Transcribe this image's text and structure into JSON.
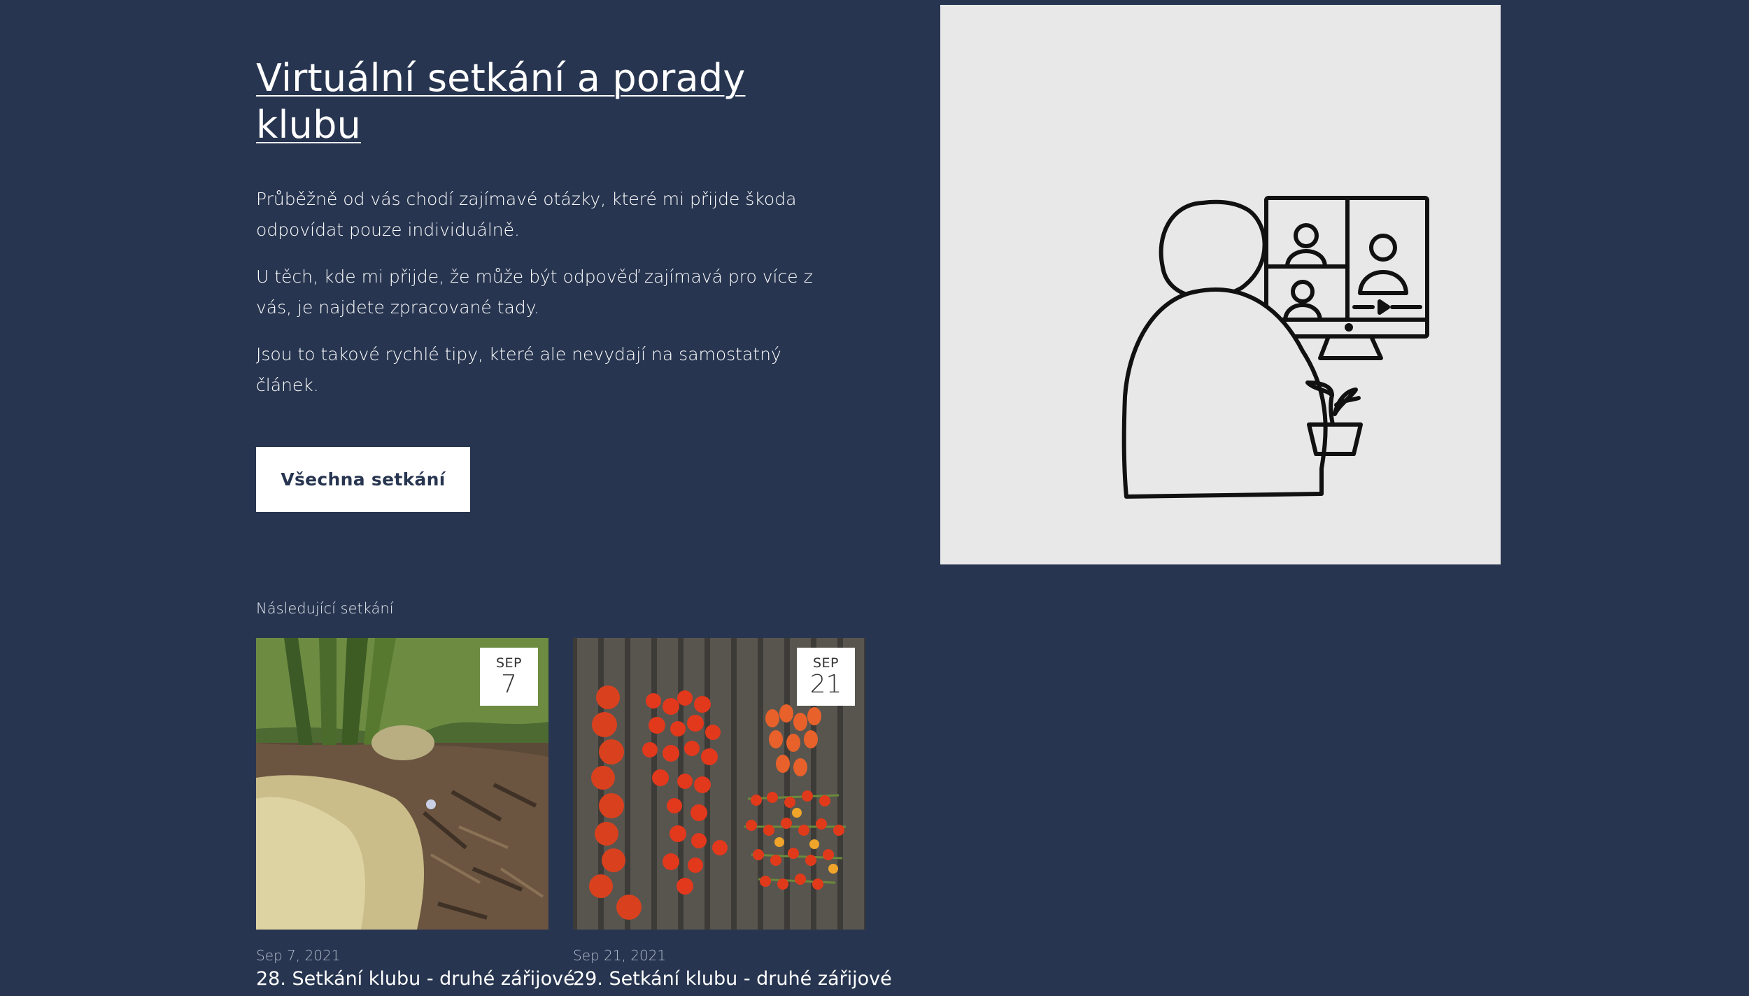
{
  "hero": {
    "title": "Virtuální setkání a porady klubu",
    "paragraphs": [
      "Průběžně od vás chodí zajímavé otázky, které mi přijde škoda odpovídat pouze individuálně.",
      "U těch, kde mi přijde,  že může být odpověď zajímavá pro více z vás, je najdete zpracované tady.",
      "Jsou to takové rychlé tipy, které ale nevydají na samostatný článek."
    ],
    "button_label": "Všechna setkání"
  },
  "illustration": {
    "icon": "video-call-illustration",
    "background": "#e8e8e8"
  },
  "upcoming": {
    "label": "Následující setkání",
    "events": [
      {
        "month": "SEP",
        "day": "7",
        "date": "Sep 7, 2021",
        "title": "28. Setkání klubu - druhé zářijové",
        "image": "celery-plant-photo"
      },
      {
        "month": "SEP",
        "day": "21",
        "date": "Sep 21, 2021",
        "title": "29. Setkání klubu - druhé zářijové",
        "image": "tomatoes-on-wood-photo"
      }
    ]
  },
  "colors": {
    "background": "#273550",
    "text": "#ffffff",
    "button_bg": "#ffffff",
    "button_text": "#273550"
  }
}
